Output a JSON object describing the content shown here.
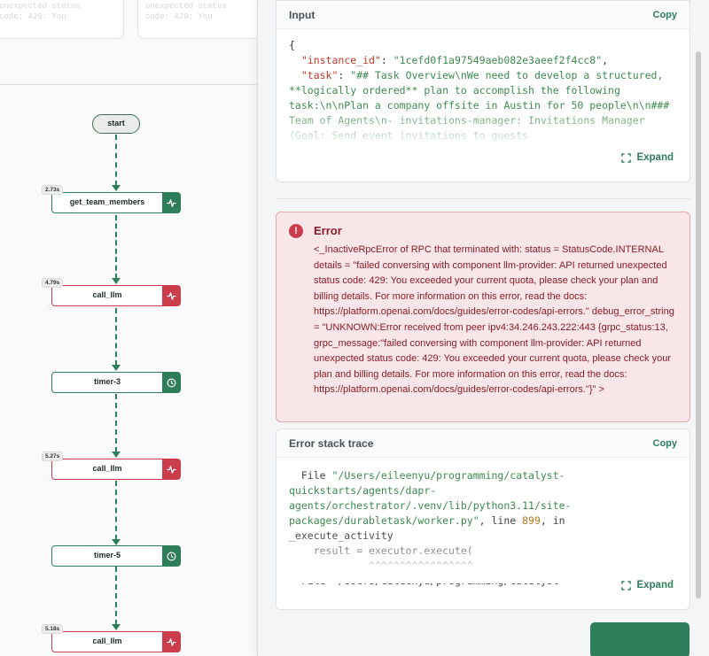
{
  "top_cards": [
    {
      "ghost_lines": [
        "unexpected status",
        "code: 429: You"
      ]
    },
    {
      "ghost_lines": [
        "unexpected status",
        "code: 429: You"
      ]
    }
  ],
  "workflow": {
    "start_label": "start",
    "nodes": [
      {
        "label": "get_team_members",
        "duration": "2.73s",
        "status": "success",
        "icon": "activity-icon"
      },
      {
        "label": "call_llm",
        "duration": "4.79s",
        "status": "error",
        "icon": "activity-icon"
      },
      {
        "label": "timer-3",
        "duration": "",
        "status": "success",
        "icon": "clock-icon"
      },
      {
        "label": "call_llm",
        "duration": "5.27s",
        "status": "error",
        "icon": "activity-icon"
      },
      {
        "label": "timer-5",
        "duration": "",
        "status": "success",
        "icon": "clock-icon"
      },
      {
        "label": "call_llm",
        "duration": "5.18s",
        "status": "error",
        "icon": "activity-icon"
      }
    ]
  },
  "input_card": {
    "title": "Input",
    "copy_label": "Copy",
    "expand_label": "Expand",
    "json_open": "{",
    "instance_id_key": "\"instance_id\"",
    "instance_id_value": "\"1cefd0f1a97549aeb082e3aeef2f4cc8\"",
    "task_key": "\"task\"",
    "task_value": "\"## Task Overview\\nWe need to develop a structured, **logically ordered** plan to accomplish the following task:\\n\\nPlan a company offsite in Austin for 50 people\\n\\n### Team of Agents\\n- invitations-manager: Invitations Manager (Goal: Send event invitations to guests"
  },
  "error": {
    "title": "Error",
    "message": "<_InactiveRpcError of RPC that terminated with: status = StatusCode.INTERNAL details = \"failed conversing with component llm-provider: API returned unexpected status code: 429: You exceeded your current quota, please check your plan and billing details. For more information on this error, read the docs: https://platform.openai.com/docs/guides/error-codes/api-errors.\" debug_error_string = \"UNKNOWN:Error received from peer ipv4:34.246.243.222:443 {grpc_status:13, grpc_message:\"failed conversing with component llm-provider: API returned unexpected status code: 429: You exceeded your current quota, please check your plan and billing details. For more information on this error, read the docs: https://platform.openai.com/docs/guides/error-codes/api-errors.\"}\" >"
  },
  "stack_trace_card": {
    "title": "Error stack trace",
    "copy_label": "Copy",
    "expand_label": "Expand",
    "file_prefix": "  File ",
    "file_path": "\"/Users/eileenyu/programming/catalyst-quickstarts/agents/dapr-agents/orchestrator/.venv/lib/python3.11/site-packages/durabletask/worker.py\"",
    "line_text": ", line ",
    "line_number": "899",
    "in_text": ", in",
    "function_name": "_execute_activity",
    "code_line": "    result = executor.execute(",
    "caret_line": "             ^^^^^^^^^^^^^^^^^",
    "next_line": "  File \"/Users/eileenyu/programming/catalyst-"
  },
  "colors": {
    "accent": "#2e7d5b",
    "error": "#cc3d4c",
    "error_bg": "#f9e6e8",
    "error_text": "#8b1c27"
  }
}
